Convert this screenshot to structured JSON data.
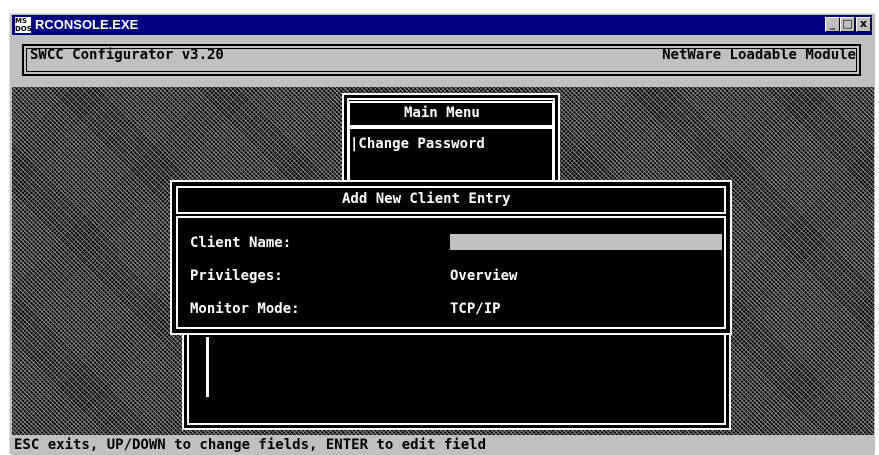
{
  "window": {
    "title": "RCONSOLE.EXE",
    "icon_name": "ms-dos-icon",
    "icon_text": [
      "MS",
      "DOS"
    ]
  },
  "controls": {
    "minimize": "_",
    "maximize": "□",
    "close": "x"
  },
  "header": {
    "left": "SWCC Configurator  v3.20",
    "right": "NetWare Loadable Module"
  },
  "main_menu": {
    "title": "Main Menu",
    "items": [
      "|Change Password"
    ]
  },
  "dialog": {
    "title": "Add New Client Entry",
    "fields": [
      {
        "label": "Client Name:",
        "value": ""
      },
      {
        "label": "Privileges:",
        "value": "Overview"
      },
      {
        "label": "Monitor Mode:",
        "value": "TCP/IP"
      }
    ]
  },
  "status_bar": "ESC exits, UP/DOWN to change fields, ENTER to edit field",
  "colors": {
    "title_bar": "#000080",
    "window": "#c0c0c0",
    "screen": "#000000",
    "text": "#ffffff",
    "field_highlight": "#c0c0c0"
  }
}
